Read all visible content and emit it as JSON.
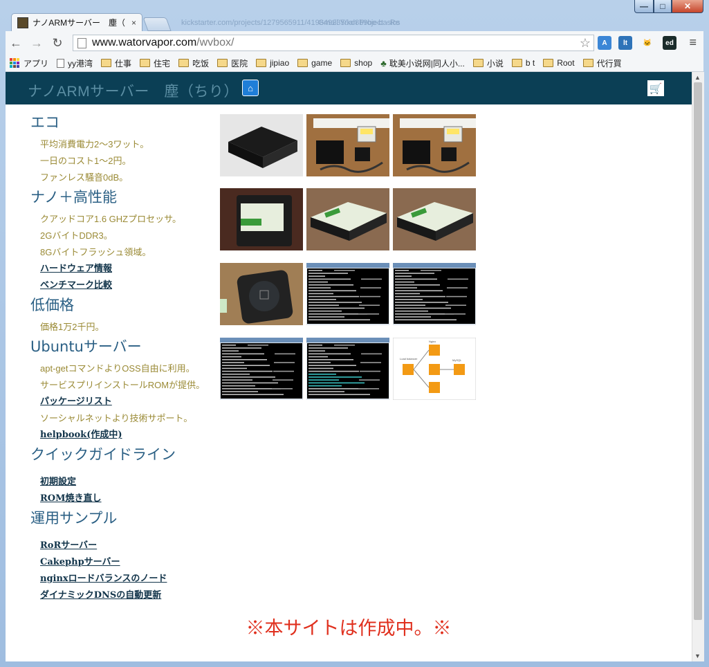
{
  "browser": {
    "tab_title": "ナノARMサーバー　塵（",
    "tab_close": "×",
    "ghost_tabs": [
      "kickstarter.com/projects/1279565911/419849235/kd8b9be-basics",
      "Gmail Yuan Project - Re"
    ],
    "window_controls": {
      "minimize": "—",
      "maximize": "□",
      "close": "✕"
    },
    "nav": {
      "back": "←",
      "forward": "→",
      "reload": "↻"
    },
    "url_host": "www.watorvapor.com",
    "url_path": "/wvbox/",
    "star": "☆",
    "menu": "≡",
    "extensions": [
      {
        "name": "translate-extension-icon",
        "label": "A",
        "color": "#3b86d6"
      },
      {
        "name": "lt-extension-icon",
        "label": "lt",
        "color": "#2e73b8"
      },
      {
        "name": "github-extension-icon",
        "label": "🐱",
        "color": "#f4f6f8"
      },
      {
        "name": "editor-extension-icon",
        "label": "ed",
        "color": "#1a2b2a"
      }
    ],
    "bookmarks": [
      {
        "label": "アプリ",
        "type": "apps"
      },
      {
        "label": "yy港湾",
        "type": "doc"
      },
      {
        "label": "仕事",
        "type": "folder"
      },
      {
        "label": "住宅",
        "type": "folder"
      },
      {
        "label": "吃饭",
        "type": "folder"
      },
      {
        "label": "医院",
        "type": "folder"
      },
      {
        "label": "jipiao",
        "type": "folder"
      },
      {
        "label": "game",
        "type": "folder"
      },
      {
        "label": "shop",
        "type": "folder"
      },
      {
        "label": "耽美小说网|同人小...",
        "type": "tree"
      },
      {
        "label": "小说",
        "type": "folder"
      },
      {
        "label": "b t",
        "type": "folder"
      },
      {
        "label": "Root",
        "type": "folder"
      },
      {
        "label": "代行買",
        "type": "folder"
      }
    ]
  },
  "site": {
    "title": "ナノARMサーバー　塵（ちり）",
    "home_icon": "⌂",
    "cart_icon": "🛒",
    "sections": [
      {
        "heading": "エコ",
        "items": [
          {
            "text": "平均消費電力2～3ワット。",
            "link": false
          },
          {
            "text": "一日のコスト1～2円。",
            "link": false
          },
          {
            "text": "ファンレス騒音0dB。",
            "link": false
          }
        ]
      },
      {
        "heading": "ナノ＋高性能",
        "items": [
          {
            "text": "クアッドコア1.6 GHZプロセッサ。",
            "link": false
          },
          {
            "text": "2GバイトDDR3。",
            "link": false
          },
          {
            "text": "8Gバイトフラッシュ領域。",
            "link": false
          },
          {
            "text": "ハードウェア情報",
            "link": true
          },
          {
            "text": "ベンチマーク比較",
            "link": true
          }
        ]
      },
      {
        "heading": "低価格",
        "items": [
          {
            "text": "価格1万2千円。",
            "link": false
          }
        ]
      },
      {
        "heading": "Ubuntuサーバー",
        "items": [
          {
            "text": "apt-getコマンドよりOSS自由に利用。",
            "link": false
          },
          {
            "text": "サービスプリインストールROMが提供。",
            "link": false
          },
          {
            "text": "パッケージリスト",
            "link": true
          },
          {
            "text": "ソーシャルネットより技術サポート。",
            "link": false
          },
          {
            "text": "helpbook(作成中)",
            "link": true
          }
        ]
      },
      {
        "heading": "クイックガイドライン",
        "items": [
          {
            "text": "初期設定",
            "link": true
          },
          {
            "text": "ROM焼き直し",
            "link": true
          }
        ]
      },
      {
        "heading": "運用サンプル",
        "items": [
          {
            "text": "RoRサーバー",
            "link": true
          },
          {
            "text": "Cakephpサーバー",
            "link": true
          },
          {
            "text": "nginxロードバランスのノード",
            "link": true
          },
          {
            "text": "ダイナミックDNSの自動更新",
            "link": true
          }
        ]
      }
    ],
    "gallery": [
      {
        "kind": "device-black"
      },
      {
        "kind": "device-power"
      },
      {
        "kind": "device-power"
      },
      {
        "kind": "device-card-dark"
      },
      {
        "kind": "device-card-side"
      },
      {
        "kind": "device-card-front"
      },
      {
        "kind": "device-bottom"
      },
      {
        "kind": "terminal"
      },
      {
        "kind": "terminal"
      },
      {
        "kind": "terminal"
      },
      {
        "kind": "terminal-color"
      },
      {
        "kind": "diagram"
      }
    ],
    "diagram_labels": {
      "top": "Nginx",
      "left": "Load balancer",
      "right": "MySQL"
    },
    "notice": "※本サイトは作成中。※"
  }
}
